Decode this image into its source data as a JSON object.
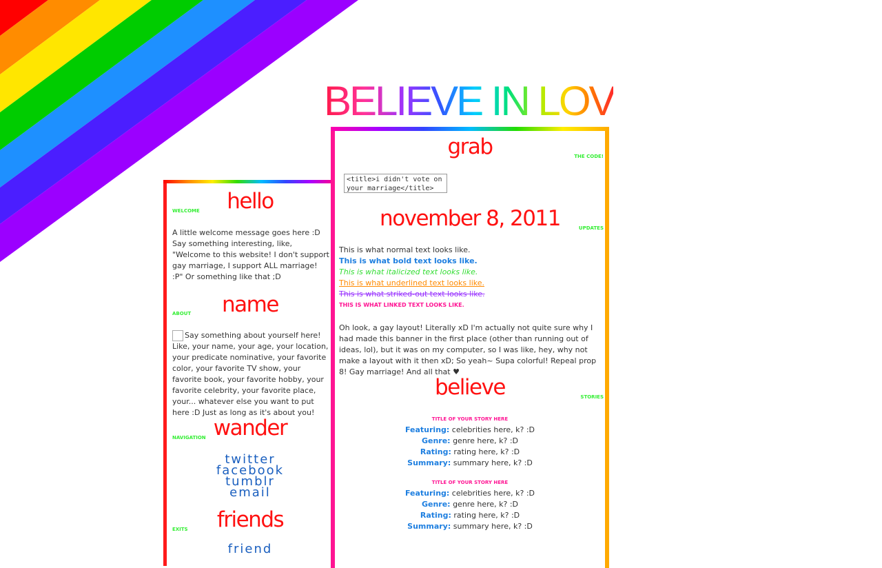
{
  "banner": {
    "text": "BELIEVE IN LOVE"
  },
  "colors": {
    "heading": "#ff1111",
    "subtitle": "#33ee33",
    "bold": "#1e7fe0",
    "italic": "#33dd33",
    "underline": "#ff8a00",
    "strike": "#9933ff",
    "link": "#ff1493",
    "nav_link": "#1a5fbf"
  },
  "left": {
    "hello": {
      "heading": "hello",
      "sub": "WELCOME",
      "text": "A little welcome message goes here :D Say something interesting, like, \"Welcome to this website! I don't support gay marriage, I support ALL marriage! :P\" Or something like that ;D"
    },
    "name": {
      "heading": "name",
      "sub": "ABOUT",
      "text": "Say something about yourself here! Like, your name, your age, your location, your predicate nominative, your favorite color, your favorite TV show, your favorite book, your favorite hobby, your favorite celebrity, your favorite place, your... whatever else you want to put here :D Just as long as it's about you!"
    },
    "wander": {
      "heading": "wander",
      "sub": "NAVIGATION",
      "links": [
        "twitter",
        "facebook",
        "tumblr",
        "email"
      ]
    },
    "friends": {
      "heading": "friends",
      "sub": "EXITS",
      "links": [
        "friend"
      ]
    }
  },
  "right": {
    "grab": {
      "heading": "grab",
      "sub": "THE CODE!",
      "code": "<title>i didn't vote on your marriage</title>"
    },
    "update": {
      "heading": "november 8, 2011",
      "sub": "UPDATES",
      "normal": "This is what normal text looks like.",
      "bold": "This is what bold text looks like.",
      "italic": "This is what italicized text looks like.",
      "underline": "This is what underlined text looks like.",
      "strike": "This is what striked-out text looks like.",
      "linked": "THIS IS WHAT LINKED TEXT LOOKS LIKE.",
      "body": "Oh look, a gay layout! Literally xD I'm actually not quite sure why I had made this banner in the first place (other than running out of ideas, lol), but it was on my computer, so I was like, hey, why not make a layout with it then xD; So yeah~ Supa colorful! Repeal prop 8! Gay marriage! And all that ♥"
    },
    "believe": {
      "heading": "believe",
      "sub": "STORIES",
      "stories": [
        {
          "title": "TITLE OF YOUR STORY HERE",
          "featuring_label": "Featuring:",
          "featuring": "celebrities here, k? :D",
          "genre_label": "Genre:",
          "genre": "genre here, k? :D",
          "rating_label": "Rating:",
          "rating": "rating here, k? :D",
          "summary_label": "Summary:",
          "summary": "summary here, k? :D"
        },
        {
          "title": "TITLE OF YOUR STORY HERE",
          "featuring_label": "Featuring:",
          "featuring": "celebrities here, k? :D",
          "genre_label": "Genre:",
          "genre": "genre here, k? :D",
          "rating_label": "Rating:",
          "rating": "rating here, k? :D",
          "summary_label": "Summary:",
          "summary": "summary here, k? :D"
        }
      ]
    }
  }
}
